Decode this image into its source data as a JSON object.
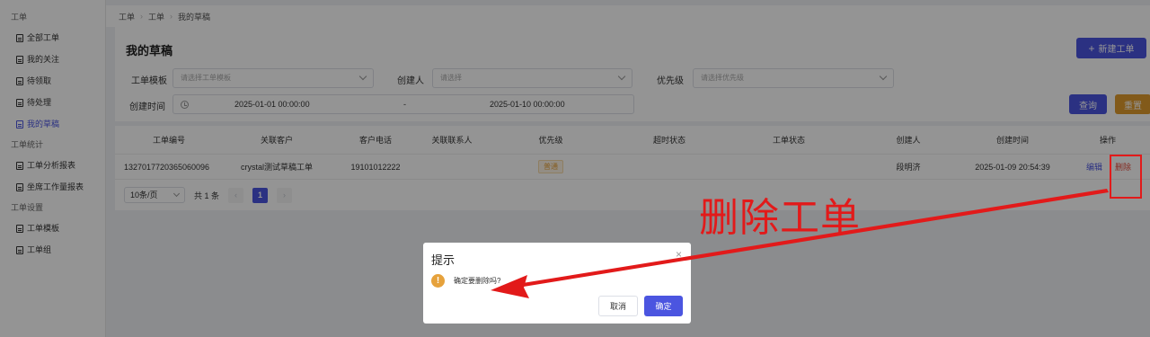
{
  "sidebar": {
    "groups": [
      {
        "label": "工单",
        "items": [
          {
            "label": "全部工单"
          },
          {
            "label": "我的关注"
          },
          {
            "label": "待领取"
          },
          {
            "label": "待处理"
          },
          {
            "label": "我的草稿",
            "active": true
          }
        ]
      },
      {
        "label": "工单统计",
        "items": [
          {
            "label": "工单分析报表"
          },
          {
            "label": "坐席工作量报表"
          }
        ]
      },
      {
        "label": "工单设置",
        "items": [
          {
            "label": "工单模板"
          },
          {
            "label": "工单组"
          }
        ]
      }
    ]
  },
  "breadcrumb": [
    "工单",
    "工单",
    "我的草稿"
  ],
  "page": {
    "title": "我的草稿",
    "new_button": "新建工单",
    "search_button": "查询",
    "reset_button": "重置"
  },
  "filters": {
    "template": {
      "label": "工单模板",
      "placeholder": "请选择工单模板"
    },
    "creator": {
      "label": "创建人",
      "placeholder": "请选择"
    },
    "priority": {
      "label": "优先级",
      "placeholder": "请选择优先级"
    },
    "created_time": {
      "label": "创建时间",
      "start": "2025-01-01 00:00:00",
      "separator": "-",
      "end": "2025-01-10 00:00:00"
    }
  },
  "table": {
    "columns": [
      "工单编号",
      "关联客户",
      "客户电话",
      "关联联系人",
      "优先级",
      "超时状态",
      "工单状态",
      "创建人",
      "创建时间",
      "操作"
    ],
    "rows": [
      {
        "id": "1327017720365060096",
        "customer": "crystal测试草稿工单",
        "phone": "19101012222",
        "contact": "",
        "priority": "普通",
        "timeout": "",
        "status": "",
        "creator": "段明济",
        "created": "2025-01-09 20:54:39",
        "edit": "编辑",
        "delete": "删除"
      }
    ]
  },
  "pagination": {
    "page_size": "10条/页",
    "total": "共 1 条",
    "current": "1",
    "prev": "‹",
    "next": "›"
  },
  "dialog": {
    "title": "提示",
    "message": "确定要删除吗?",
    "cancel": "取消",
    "confirm": "确定",
    "close": "×",
    "icon": "!"
  },
  "annotation": {
    "text": "删除工单",
    "color": "#e21a1a"
  },
  "colors": {
    "primary": "#4b55e0",
    "warning": "#e09b2d",
    "danger": "#e5493a"
  }
}
